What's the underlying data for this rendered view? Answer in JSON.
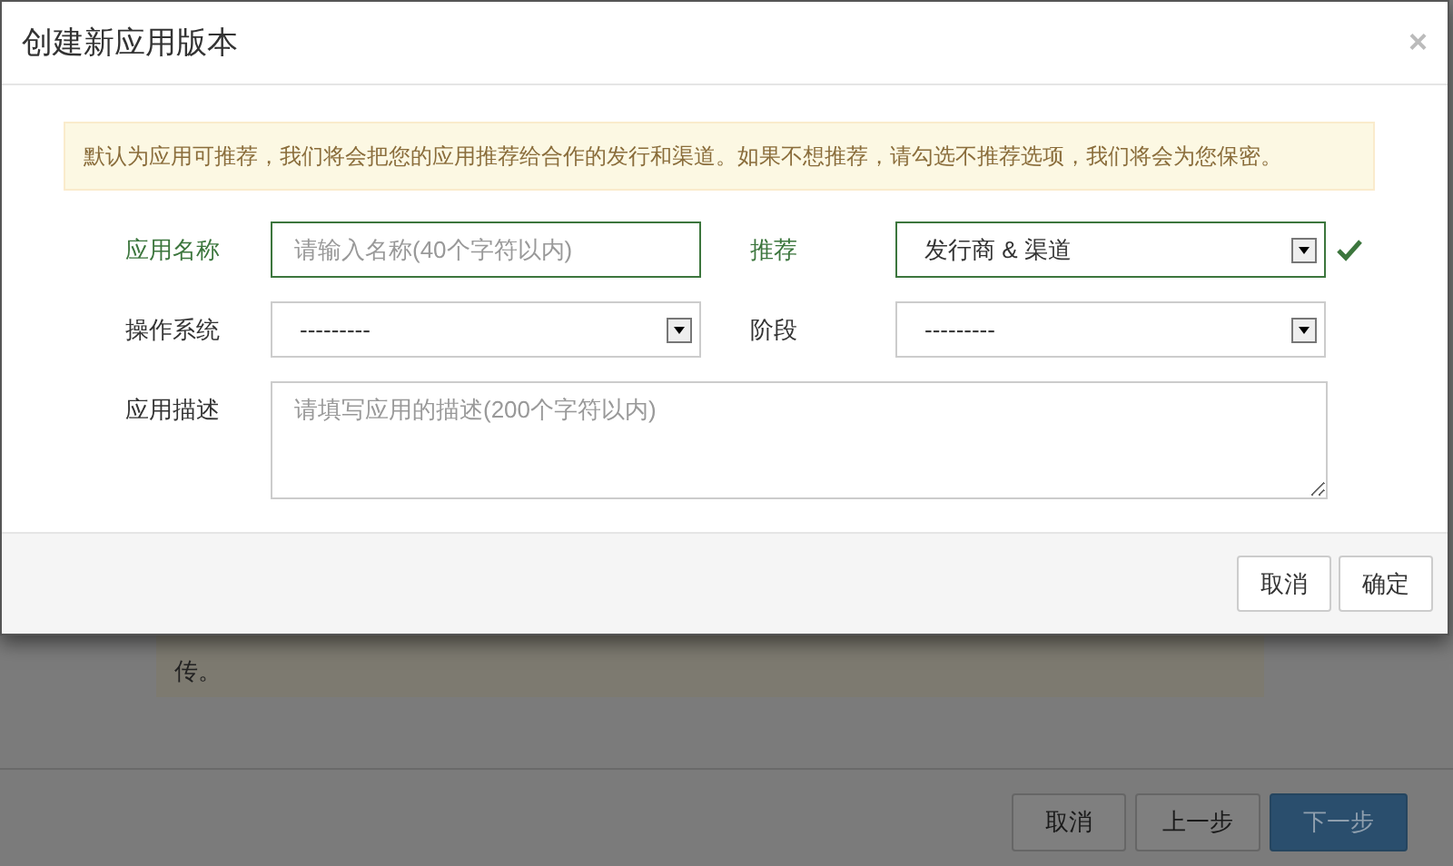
{
  "background": {
    "note_tail": "传。",
    "buttons": [
      {
        "label": "取消",
        "kind": "default"
      },
      {
        "label": "上一步",
        "kind": "default"
      },
      {
        "label": "下一步",
        "kind": "primary"
      }
    ]
  },
  "dialog": {
    "title": "创建新应用版本",
    "close": "×",
    "alert": "默认为应用可推荐，我们将会把您的应用推荐给合作的发行和渠道。如果不想推荐，请勾选不推荐选项，我们将会为您保密。",
    "rows": [
      [
        {
          "label": "应用名称",
          "kind": "input",
          "placeholder": "请输入名称(40个字符以内)",
          "valid": true
        },
        {
          "label": "推荐",
          "kind": "select",
          "value": "发行商 & 渠道",
          "valid": true
        }
      ],
      [
        {
          "label": "操作系统",
          "kind": "select",
          "value": "---------",
          "valid": false
        },
        {
          "label": "阶段",
          "kind": "select",
          "value": "---------",
          "valid": false
        }
      ],
      [
        {
          "label": "应用描述",
          "kind": "textarea",
          "placeholder": "请填写应用的描述(200个字符以内)",
          "valid": false
        }
      ]
    ],
    "buttons": [
      "取消",
      "确定"
    ]
  }
}
